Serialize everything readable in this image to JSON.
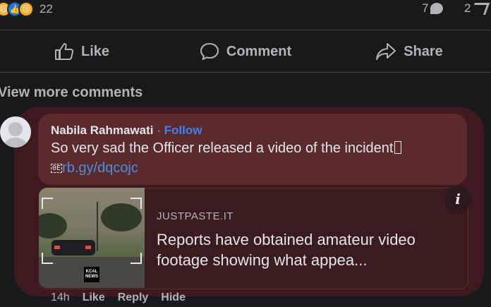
{
  "post_stats": {
    "reaction_icons": [
      "haha-reaction-icon",
      "like-reaction-icon",
      "care-reaction-icon"
    ],
    "reaction_count": "22",
    "comment_count": "7",
    "share_count": "2"
  },
  "actions": {
    "like": "Like",
    "comment": "Comment",
    "share": "Share"
  },
  "view_more": "View more comments",
  "comment": {
    "author": "Nabila Rahmawati",
    "separator": "·",
    "follow": "Follow",
    "text": "So very sad the Officer released a video of the incident",
    "tofu_glyph": "0E\n01",
    "link": "rb.gy/dqcojc",
    "time": "14h",
    "like": "Like",
    "reply": "Reply",
    "hide": "Hide"
  },
  "preview": {
    "domain": "JUSTPASTE.IT",
    "title": "Reports have obtained amateur video footage showing what appea...",
    "logo_text": "KCAL NEWS",
    "info_icon": "info-icon"
  },
  "colors": {
    "background": "#18191a",
    "highlight": "#3e1a1e",
    "bubble": "#5a2a2c",
    "follow": "#3b82f6",
    "link": "#4a90e2"
  }
}
